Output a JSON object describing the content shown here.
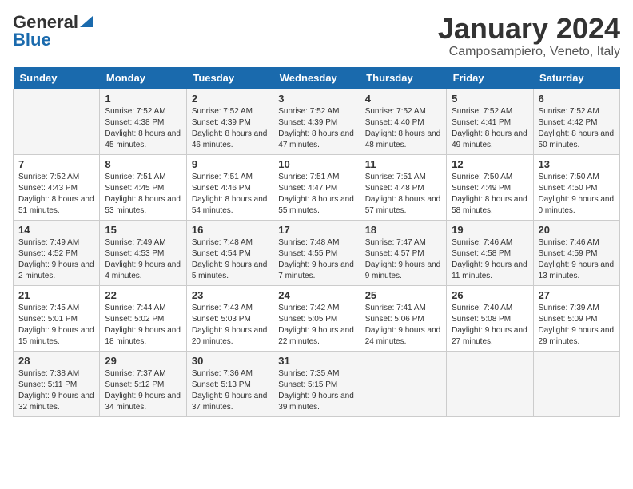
{
  "header": {
    "logo_general": "General",
    "logo_blue": "Blue",
    "month_title": "January 2024",
    "location": "Camposampiero, Veneto, Italy"
  },
  "days_of_week": [
    "Sunday",
    "Monday",
    "Tuesday",
    "Wednesday",
    "Thursday",
    "Friday",
    "Saturday"
  ],
  "weeks": [
    [
      {
        "day": "",
        "sunrise": "",
        "sunset": "",
        "daylight": ""
      },
      {
        "day": "1",
        "sunrise": "Sunrise: 7:52 AM",
        "sunset": "Sunset: 4:38 PM",
        "daylight": "Daylight: 8 hours and 45 minutes."
      },
      {
        "day": "2",
        "sunrise": "Sunrise: 7:52 AM",
        "sunset": "Sunset: 4:39 PM",
        "daylight": "Daylight: 8 hours and 46 minutes."
      },
      {
        "day": "3",
        "sunrise": "Sunrise: 7:52 AM",
        "sunset": "Sunset: 4:39 PM",
        "daylight": "Daylight: 8 hours and 47 minutes."
      },
      {
        "day": "4",
        "sunrise": "Sunrise: 7:52 AM",
        "sunset": "Sunset: 4:40 PM",
        "daylight": "Daylight: 8 hours and 48 minutes."
      },
      {
        "day": "5",
        "sunrise": "Sunrise: 7:52 AM",
        "sunset": "Sunset: 4:41 PM",
        "daylight": "Daylight: 8 hours and 49 minutes."
      },
      {
        "day": "6",
        "sunrise": "Sunrise: 7:52 AM",
        "sunset": "Sunset: 4:42 PM",
        "daylight": "Daylight: 8 hours and 50 minutes."
      }
    ],
    [
      {
        "day": "7",
        "sunrise": "Sunrise: 7:52 AM",
        "sunset": "Sunset: 4:43 PM",
        "daylight": "Daylight: 8 hours and 51 minutes."
      },
      {
        "day": "8",
        "sunrise": "Sunrise: 7:51 AM",
        "sunset": "Sunset: 4:45 PM",
        "daylight": "Daylight: 8 hours and 53 minutes."
      },
      {
        "day": "9",
        "sunrise": "Sunrise: 7:51 AM",
        "sunset": "Sunset: 4:46 PM",
        "daylight": "Daylight: 8 hours and 54 minutes."
      },
      {
        "day": "10",
        "sunrise": "Sunrise: 7:51 AM",
        "sunset": "Sunset: 4:47 PM",
        "daylight": "Daylight: 8 hours and 55 minutes."
      },
      {
        "day": "11",
        "sunrise": "Sunrise: 7:51 AM",
        "sunset": "Sunset: 4:48 PM",
        "daylight": "Daylight: 8 hours and 57 minutes."
      },
      {
        "day": "12",
        "sunrise": "Sunrise: 7:50 AM",
        "sunset": "Sunset: 4:49 PM",
        "daylight": "Daylight: 8 hours and 58 minutes."
      },
      {
        "day": "13",
        "sunrise": "Sunrise: 7:50 AM",
        "sunset": "Sunset: 4:50 PM",
        "daylight": "Daylight: 9 hours and 0 minutes."
      }
    ],
    [
      {
        "day": "14",
        "sunrise": "Sunrise: 7:49 AM",
        "sunset": "Sunset: 4:52 PM",
        "daylight": "Daylight: 9 hours and 2 minutes."
      },
      {
        "day": "15",
        "sunrise": "Sunrise: 7:49 AM",
        "sunset": "Sunset: 4:53 PM",
        "daylight": "Daylight: 9 hours and 4 minutes."
      },
      {
        "day": "16",
        "sunrise": "Sunrise: 7:48 AM",
        "sunset": "Sunset: 4:54 PM",
        "daylight": "Daylight: 9 hours and 5 minutes."
      },
      {
        "day": "17",
        "sunrise": "Sunrise: 7:48 AM",
        "sunset": "Sunset: 4:55 PM",
        "daylight": "Daylight: 9 hours and 7 minutes."
      },
      {
        "day": "18",
        "sunrise": "Sunrise: 7:47 AM",
        "sunset": "Sunset: 4:57 PM",
        "daylight": "Daylight: 9 hours and 9 minutes."
      },
      {
        "day": "19",
        "sunrise": "Sunrise: 7:46 AM",
        "sunset": "Sunset: 4:58 PM",
        "daylight": "Daylight: 9 hours and 11 minutes."
      },
      {
        "day": "20",
        "sunrise": "Sunrise: 7:46 AM",
        "sunset": "Sunset: 4:59 PM",
        "daylight": "Daylight: 9 hours and 13 minutes."
      }
    ],
    [
      {
        "day": "21",
        "sunrise": "Sunrise: 7:45 AM",
        "sunset": "Sunset: 5:01 PM",
        "daylight": "Daylight: 9 hours and 15 minutes."
      },
      {
        "day": "22",
        "sunrise": "Sunrise: 7:44 AM",
        "sunset": "Sunset: 5:02 PM",
        "daylight": "Daylight: 9 hours and 18 minutes."
      },
      {
        "day": "23",
        "sunrise": "Sunrise: 7:43 AM",
        "sunset": "Sunset: 5:03 PM",
        "daylight": "Daylight: 9 hours and 20 minutes."
      },
      {
        "day": "24",
        "sunrise": "Sunrise: 7:42 AM",
        "sunset": "Sunset: 5:05 PM",
        "daylight": "Daylight: 9 hours and 22 minutes."
      },
      {
        "day": "25",
        "sunrise": "Sunrise: 7:41 AM",
        "sunset": "Sunset: 5:06 PM",
        "daylight": "Daylight: 9 hours and 24 minutes."
      },
      {
        "day": "26",
        "sunrise": "Sunrise: 7:40 AM",
        "sunset": "Sunset: 5:08 PM",
        "daylight": "Daylight: 9 hours and 27 minutes."
      },
      {
        "day": "27",
        "sunrise": "Sunrise: 7:39 AM",
        "sunset": "Sunset: 5:09 PM",
        "daylight": "Daylight: 9 hours and 29 minutes."
      }
    ],
    [
      {
        "day": "28",
        "sunrise": "Sunrise: 7:38 AM",
        "sunset": "Sunset: 5:11 PM",
        "daylight": "Daylight: 9 hours and 32 minutes."
      },
      {
        "day": "29",
        "sunrise": "Sunrise: 7:37 AM",
        "sunset": "Sunset: 5:12 PM",
        "daylight": "Daylight: 9 hours and 34 minutes."
      },
      {
        "day": "30",
        "sunrise": "Sunrise: 7:36 AM",
        "sunset": "Sunset: 5:13 PM",
        "daylight": "Daylight: 9 hours and 37 minutes."
      },
      {
        "day": "31",
        "sunrise": "Sunrise: 7:35 AM",
        "sunset": "Sunset: 5:15 PM",
        "daylight": "Daylight: 9 hours and 39 minutes."
      },
      {
        "day": "",
        "sunrise": "",
        "sunset": "",
        "daylight": ""
      },
      {
        "day": "",
        "sunrise": "",
        "sunset": "",
        "daylight": ""
      },
      {
        "day": "",
        "sunrise": "",
        "sunset": "",
        "daylight": ""
      }
    ]
  ]
}
